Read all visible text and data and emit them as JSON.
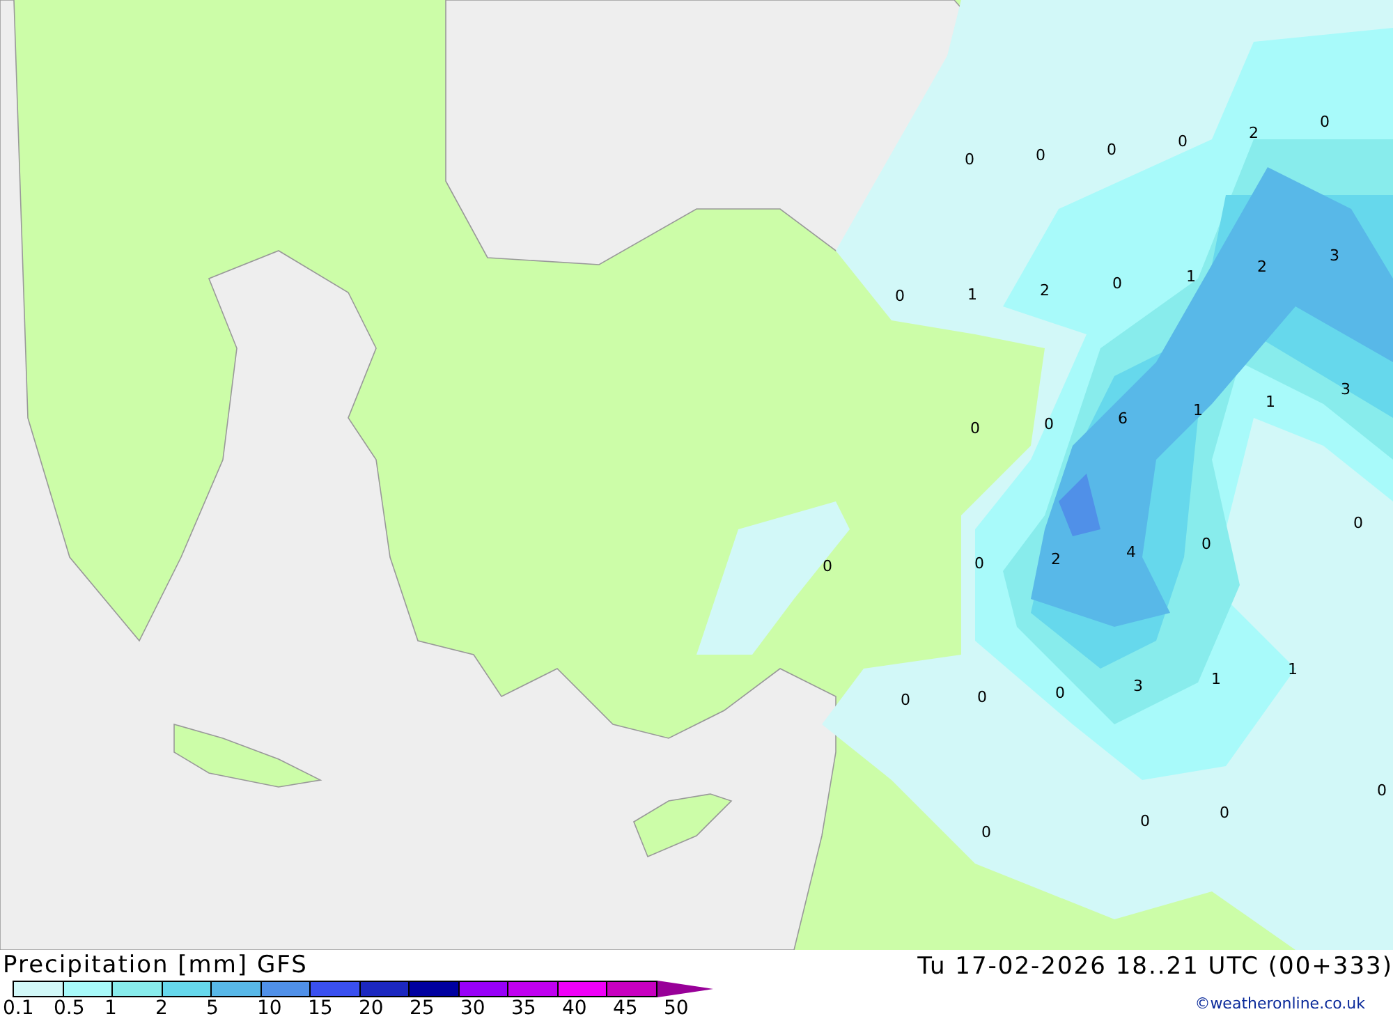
{
  "map": {
    "values": [
      "0",
      "0",
      "0",
      "0",
      "2",
      "0",
      "0",
      "1",
      "2",
      "0",
      "1",
      "2",
      "3",
      "0",
      "0",
      "6",
      "1",
      "1",
      "3",
      "0",
      "0",
      "2",
      "4",
      "0",
      "0",
      "0",
      "0",
      "0",
      "3",
      "1",
      "1",
      "0",
      "0",
      "0",
      "0"
    ]
  },
  "footer": {
    "title": "Precipitation [mm] GFS",
    "timestamp": "Tu 17-02-2026 18..21 UTC (00+333)",
    "credit": "©weatheronline.co.uk"
  },
  "legend": {
    "bins": [
      {
        "color": "#d2f8f8"
      },
      {
        "color": "#a8fafa"
      },
      {
        "color": "#88ecec"
      },
      {
        "color": "#66d8ec"
      },
      {
        "color": "#58b8e8"
      },
      {
        "color": "#5090e8"
      },
      {
        "color": "#3a50f0"
      },
      {
        "color": "#1c28c0"
      },
      {
        "color": "#0000a0"
      },
      {
        "color": "#9800f8"
      },
      {
        "color": "#c000f0"
      },
      {
        "color": "#f000f8"
      },
      {
        "color": "#c800c0"
      }
    ],
    "ticks": [
      "0.1",
      "0.5",
      "1",
      "2",
      "5",
      "10",
      "15",
      "20",
      "25",
      "30",
      "35",
      "40",
      "45",
      "50"
    ]
  }
}
